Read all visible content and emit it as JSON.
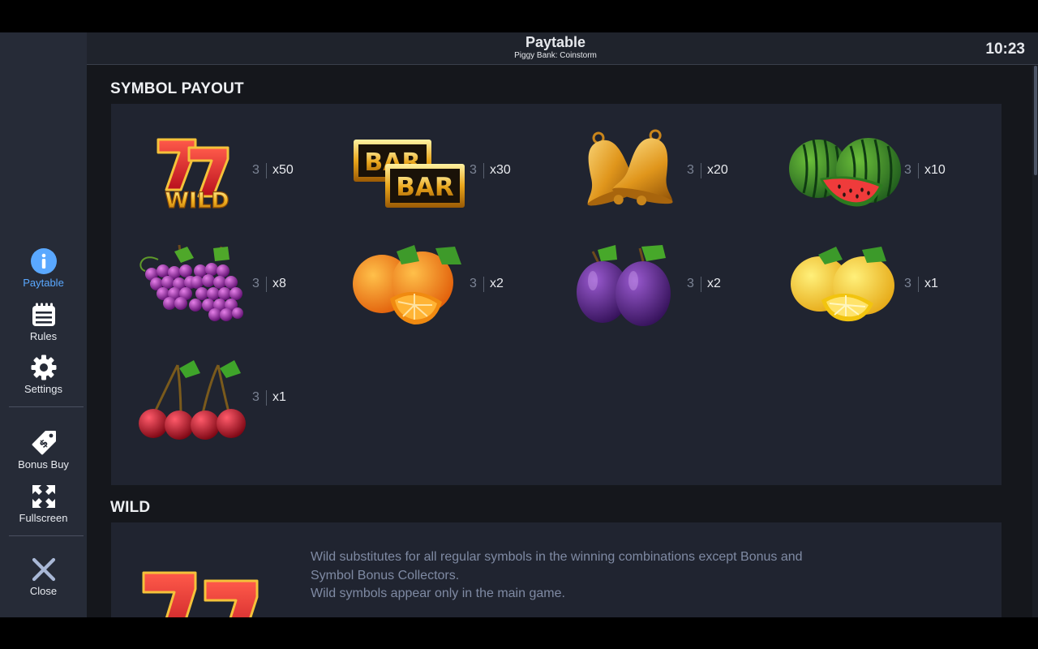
{
  "header": {
    "title": "Paytable",
    "subtitle": "Piggy Bank: Coinstorm",
    "clock": "10:23"
  },
  "sidebar": {
    "items": [
      {
        "label": "Paytable",
        "icon": "info-icon",
        "active": true
      },
      {
        "label": "Rules",
        "icon": "notepad-icon"
      },
      {
        "label": "Settings",
        "icon": "gear-icon"
      },
      {
        "label": "Bonus Buy",
        "icon": "price-tag-icon"
      },
      {
        "label": "Fullscreen",
        "icon": "expand-icon"
      },
      {
        "label": "Close",
        "icon": "close-icon"
      }
    ]
  },
  "symbol_payout": {
    "title": "SYMBOL PAYOUT",
    "symbols": [
      {
        "symbol": "wild-seven",
        "count": "3",
        "payout": "x50"
      },
      {
        "symbol": "bar",
        "count": "3",
        "payout": "x30"
      },
      {
        "symbol": "bells",
        "count": "3",
        "payout": "x20"
      },
      {
        "symbol": "watermelon",
        "count": "3",
        "payout": "x10"
      },
      {
        "symbol": "grapes",
        "count": "3",
        "payout": "x8"
      },
      {
        "symbol": "orange",
        "count": "3",
        "payout": "x2"
      },
      {
        "symbol": "plum",
        "count": "3",
        "payout": "x2"
      },
      {
        "symbol": "lemon",
        "count": "3",
        "payout": "x1"
      },
      {
        "symbol": "cherries",
        "count": "3",
        "payout": "x1"
      }
    ]
  },
  "wild": {
    "title": "WILD",
    "lines": [
      "Wild substitutes for all regular symbols in the winning combinations except Bonus and",
      "Symbol Bonus Collectors.",
      "Wild symbols appear only in the main game."
    ]
  },
  "art_text": {
    "wild_label": "WILD",
    "bar_label": "BAR"
  },
  "colors": {
    "accent": "#5aa8ff",
    "sidebar_bg": "#262b37",
    "panel_bg": "#202430"
  }
}
